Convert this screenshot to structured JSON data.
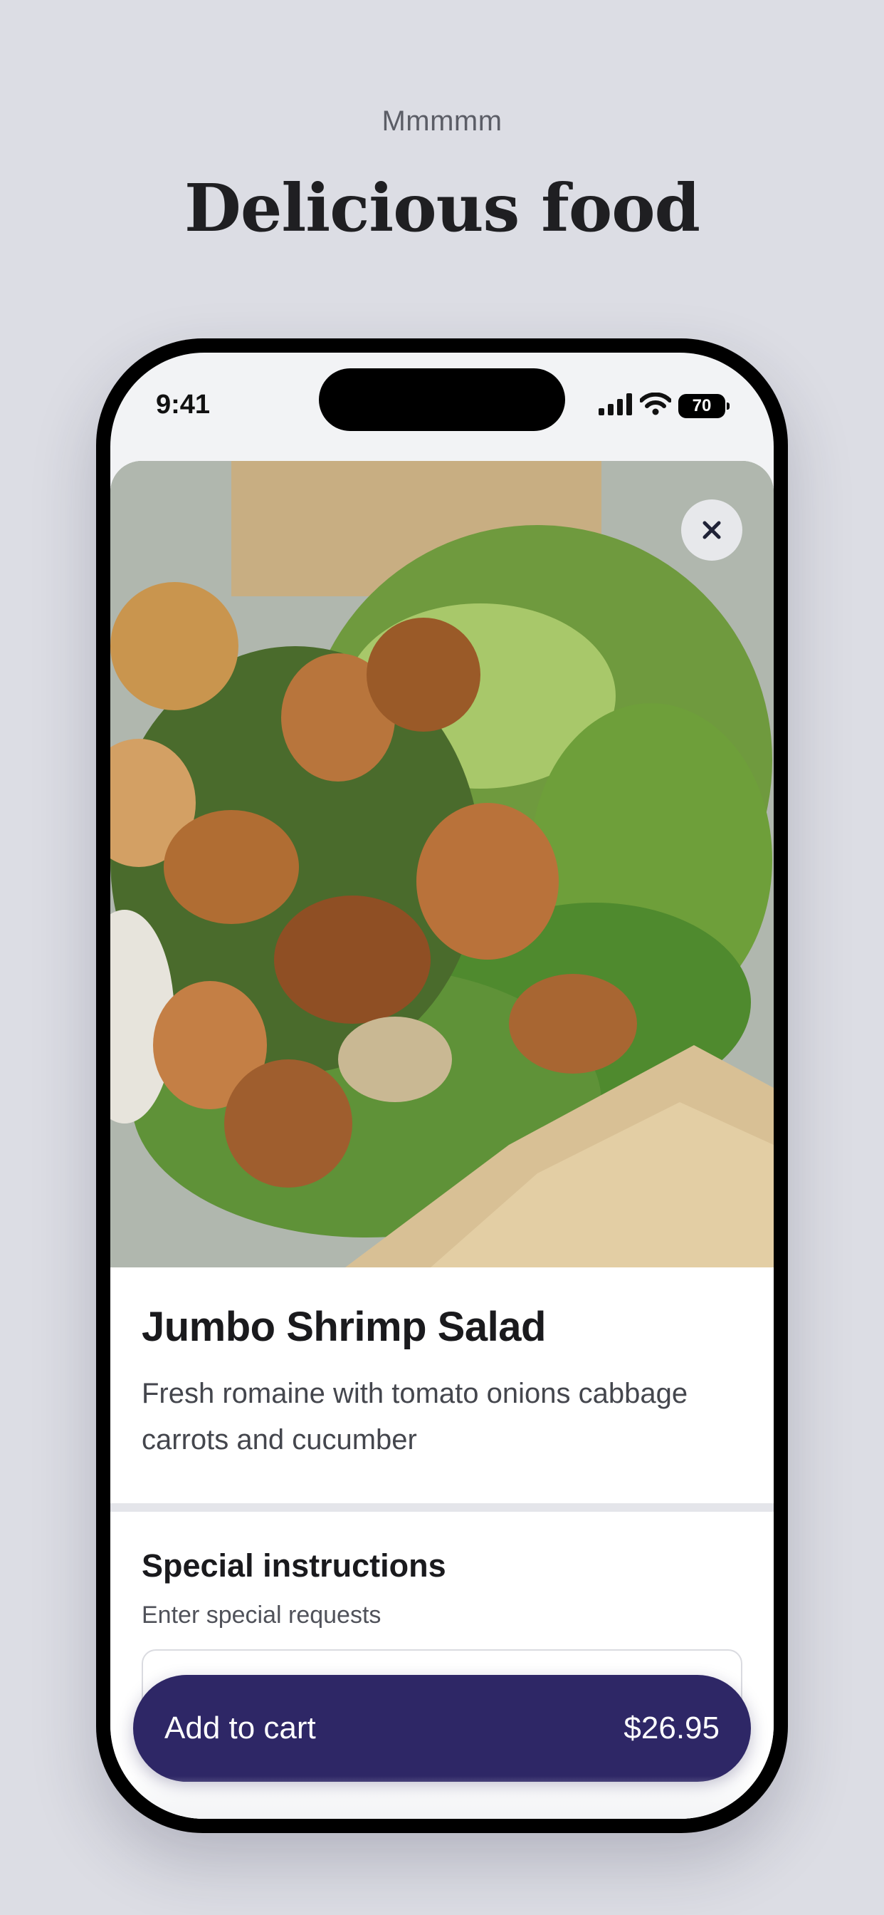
{
  "promo": {
    "eyebrow": "Mmmmm",
    "title": "Delicious food"
  },
  "status_bar": {
    "time": "9:41",
    "battery": "70"
  },
  "item": {
    "name": "Jumbo Shrimp Salad",
    "description": "Fresh romaine with tomato onions cabbage carrots and cucumber"
  },
  "instructions": {
    "title": "Special instructions",
    "subtitle": "Enter special requests",
    "value": ""
  },
  "cart": {
    "label": "Add to cart",
    "price": "$26.95"
  },
  "colors": {
    "background": "#dcdde4",
    "accent": "#2e2766"
  }
}
